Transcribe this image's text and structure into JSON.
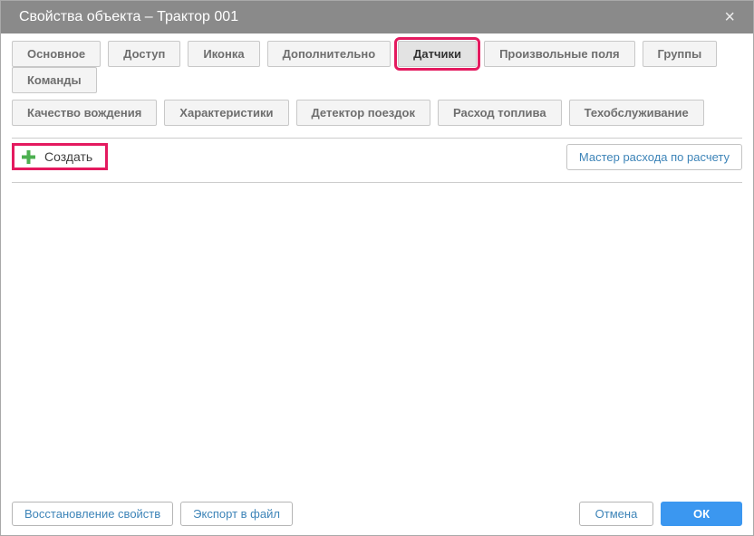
{
  "dialog": {
    "title": "Свойства объекта – Трактор 001",
    "close_glyph": "×"
  },
  "tabs": {
    "row1": [
      {
        "label": "Основное",
        "active": false
      },
      {
        "label": "Доступ",
        "active": false
      },
      {
        "label": "Иконка",
        "active": false
      },
      {
        "label": "Дополнительно",
        "active": false
      },
      {
        "label": "Датчики",
        "active": true,
        "highlighted": true
      },
      {
        "label": "Произвольные поля",
        "active": false
      },
      {
        "label": "Группы",
        "active": false
      },
      {
        "label": "Команды",
        "active": false
      }
    ],
    "row2": [
      {
        "label": "Качество вождения",
        "active": false
      },
      {
        "label": "Характеристики",
        "active": false
      },
      {
        "label": "Детектор поездок",
        "active": false
      },
      {
        "label": "Расход топлива",
        "active": false
      },
      {
        "label": "Техобслуживание",
        "active": false
      }
    ]
  },
  "toolbar": {
    "create_label": "Создать",
    "create_highlighted": true,
    "wizard_label": "Мастер расхода по расчету"
  },
  "footer": {
    "restore_label": "Восстановление свойств",
    "export_label": "Экспорт в файл",
    "cancel_label": "Отмена",
    "ok_label": "ОК"
  },
  "colors": {
    "titlebar": "#8a8a8a",
    "annotation_highlight": "#e41a5f",
    "primary_button": "#3b97f0",
    "link_text": "#3d84b8",
    "plus_green": "#4caf50",
    "active_tab_bg": "#e3e3e3",
    "tab_bg": "#f4f4f4"
  }
}
